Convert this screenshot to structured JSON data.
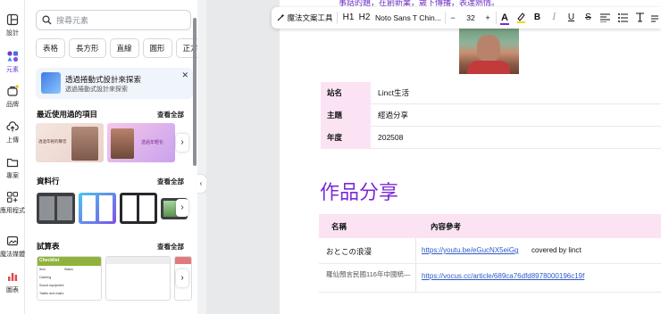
{
  "rail": {
    "items": [
      {
        "label": "設計",
        "icon": "layout-icon"
      },
      {
        "label": "元素",
        "icon": "elements-icon"
      },
      {
        "label": "品牌",
        "icon": "brand-icon"
      },
      {
        "label": "上傳",
        "icon": "upload-icon"
      },
      {
        "label": "專案",
        "icon": "folder-icon"
      },
      {
        "label": "應用程式",
        "icon": "apps-icon"
      },
      {
        "label": "魔法媒體工具",
        "icon": "magic-media-icon"
      },
      {
        "label": "圖表",
        "icon": "chart-icon"
      }
    ]
  },
  "panel": {
    "search_placeholder": "搜尋元素",
    "chips": [
      "表格",
      "長方形",
      "直線",
      "圓形",
      "正方形"
    ],
    "promo": {
      "title": "透過捲動式設計來探索",
      "subtitle": "透過捲動式設計來探索"
    },
    "recent": {
      "title": "最近使用過的項目",
      "see_all": "查看全部"
    },
    "recent_card_text": {
      "a": "透過年輕的聲音",
      "b": "透過年輕化"
    },
    "frames": {
      "title": "資料行",
      "see_all": "查看全部"
    },
    "sheets": {
      "title": "試算表",
      "see_all": "查看全部"
    },
    "sheet_card": {
      "header": "Checklist",
      "col1": "Item",
      "col2": "Status",
      "rows": [
        "Catering",
        "Sound equipment",
        "Tables and chairs"
      ]
    }
  },
  "toolbar": {
    "magic": "魔法文案工具",
    "h1": "H1",
    "h2": "H2",
    "font": "Noto Sans T Chin...",
    "minus": "−",
    "size": "32",
    "plus": "+",
    "color_letter": "A",
    "bold": "B",
    "italic": "I",
    "underline": "U",
    "strike": "S"
  },
  "page": {
    "top_text": "事話的題，在創新業，歲下傳播，表達熱情。",
    "info": [
      {
        "key": "站名",
        "value": "Linct生活"
      },
      {
        "key": "主題",
        "value": "經過分享"
      },
      {
        "key": "年度",
        "value": "202508"
      }
    ],
    "works_title": "作品分享",
    "works_header": {
      "name": "名稱",
      "ref": "內容參考"
    },
    "works_rows": [
      {
        "name": "おとこの浪漫",
        "link": "https://youtu.be/eGucNX5eiGg",
        "note": "covered by linct"
      },
      {
        "name": "羅仙預言民國116年中國統—",
        "link": "https://vocus.cc/article/689ca76dfd8978000196c19f",
        "note": ""
      }
    ]
  }
}
